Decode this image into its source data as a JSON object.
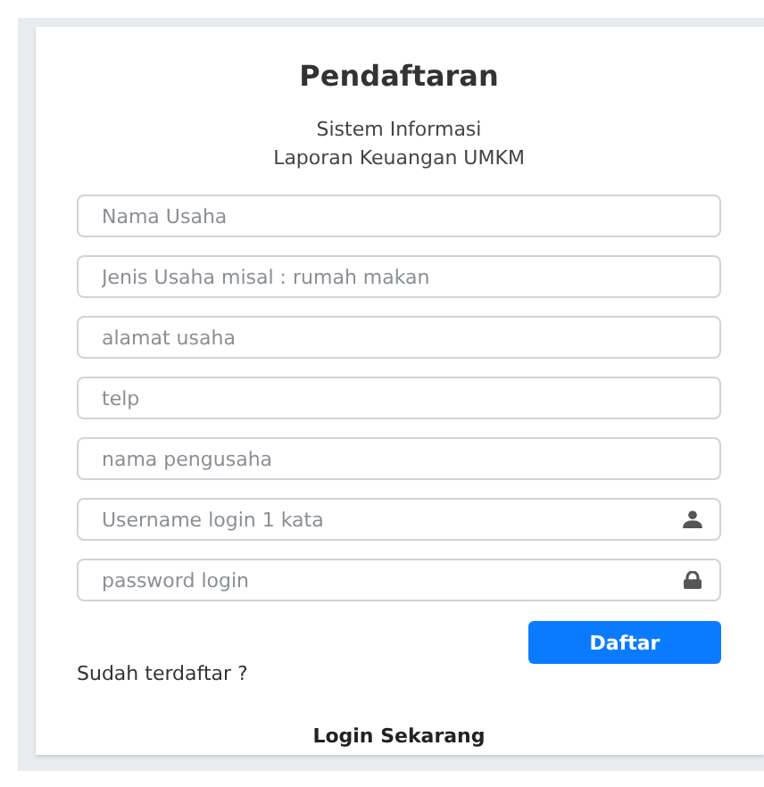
{
  "title": "Pendaftaran",
  "subtitle": [
    "Sistem Informasi",
    "Laporan Keuangan UMKM"
  ],
  "fields": [
    {
      "placeholder": "Nama Usaha",
      "kind": "plain"
    },
    {
      "placeholder": "Jenis Usaha misal : rumah makan",
      "kind": "plain"
    },
    {
      "placeholder": "alamat usaha",
      "kind": "plain"
    },
    {
      "placeholder": "telp",
      "kind": "plain"
    },
    {
      "placeholder": "nama pengusaha",
      "kind": "plain"
    },
    {
      "placeholder": "Username login 1 kata",
      "kind": "user"
    },
    {
      "placeholder": "password login",
      "kind": "password"
    }
  ],
  "submit_button": "Daftar",
  "registered_prompt": "Sudah terdaftar ?",
  "login_link": "Login Sekarang"
}
